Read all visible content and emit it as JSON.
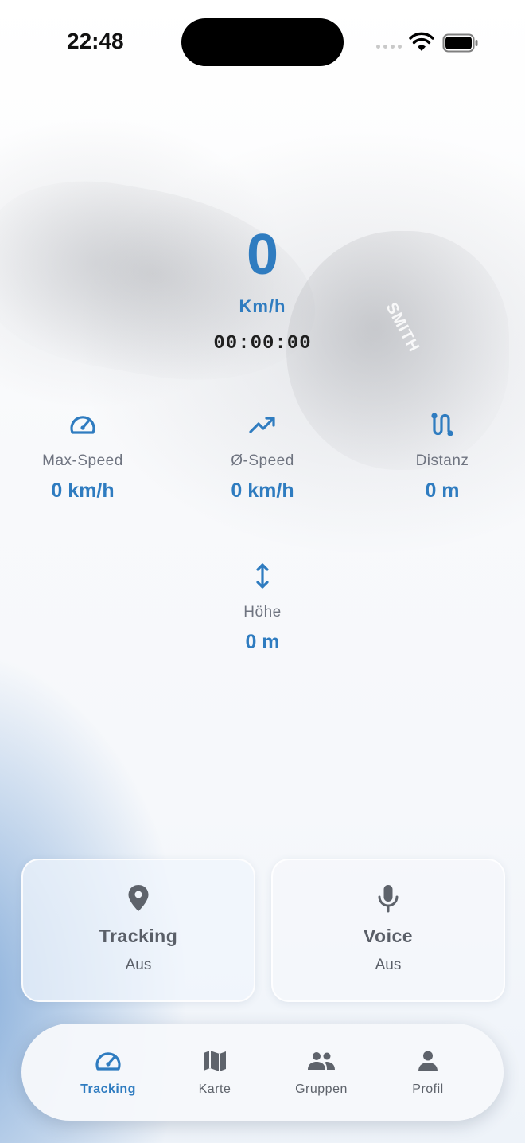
{
  "status_bar": {
    "time": "22:48"
  },
  "background": {
    "helmet_text": "SMITH"
  },
  "speed": {
    "value": "0",
    "unit": "Km/h",
    "timer": "00:00:00"
  },
  "stats": {
    "max_speed": {
      "label": "Max-Speed",
      "value": "0 km/h",
      "icon": "speedometer-icon"
    },
    "avg_speed": {
      "label": "Ø-Speed",
      "value": "0 km/h",
      "icon": "trending-up-icon"
    },
    "distance": {
      "label": "Distanz",
      "value": "0 m",
      "icon": "route-icon"
    },
    "altitude": {
      "label": "Höhe",
      "value": "0 m",
      "icon": "vertical-arrows-icon"
    }
  },
  "toggles": {
    "tracking": {
      "title": "Tracking",
      "state": "Aus",
      "icon": "location-pin-icon"
    },
    "voice": {
      "title": "Voice",
      "state": "Aus",
      "icon": "microphone-icon"
    }
  },
  "tabs": [
    {
      "label": "Tracking",
      "icon": "speedometer-icon",
      "active": true
    },
    {
      "label": "Karte",
      "icon": "map-icon",
      "active": false
    },
    {
      "label": "Gruppen",
      "icon": "group-icon",
      "active": false
    },
    {
      "label": "Profil",
      "icon": "person-icon",
      "active": false
    }
  ],
  "colors": {
    "accent": "#2f7cc0",
    "text_muted": "#6f7480",
    "icon_gray": "#5e636b"
  }
}
